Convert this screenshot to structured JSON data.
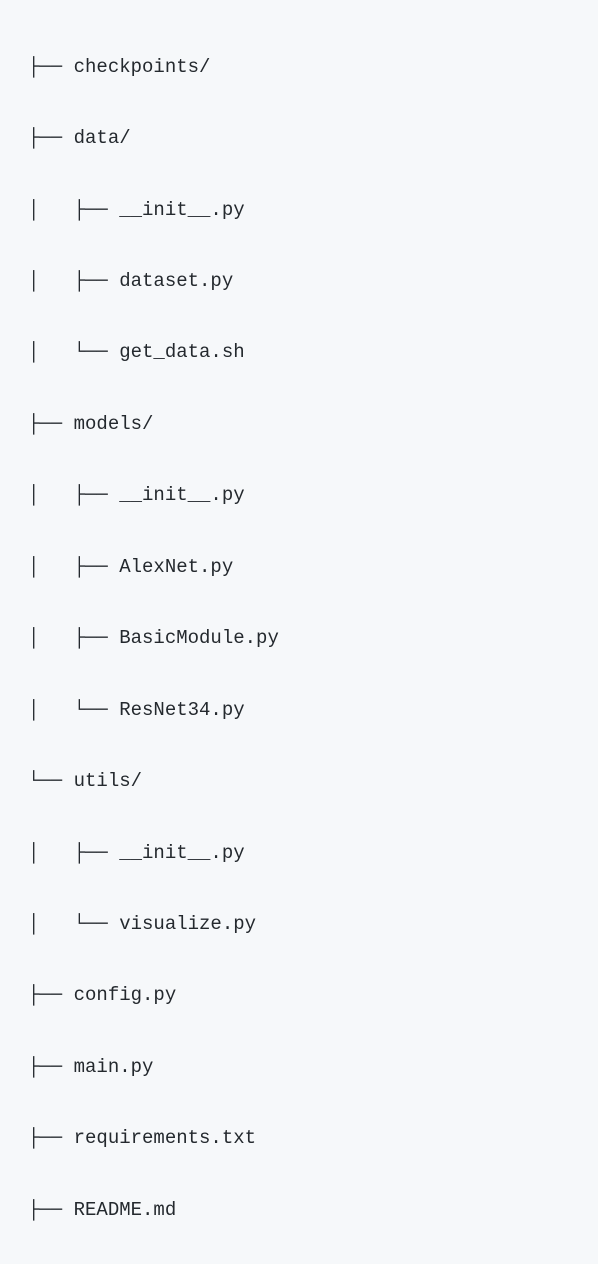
{
  "tree": {
    "lines": [
      "├── checkpoints/",
      "├── data/",
      "│   ├── __init__.py",
      "│   ├── dataset.py",
      "│   └── get_data.sh",
      "├── models/",
      "│   ├── __init__.py",
      "│   ├── AlexNet.py",
      "│   ├── BasicModule.py",
      "│   └── ResNet34.py",
      "└── utils/",
      "│   ├── __init__.py",
      "│   └── visualize.py",
      "├── config.py",
      "├── main.py",
      "├── requirements.txt",
      "├── README.md"
    ]
  }
}
